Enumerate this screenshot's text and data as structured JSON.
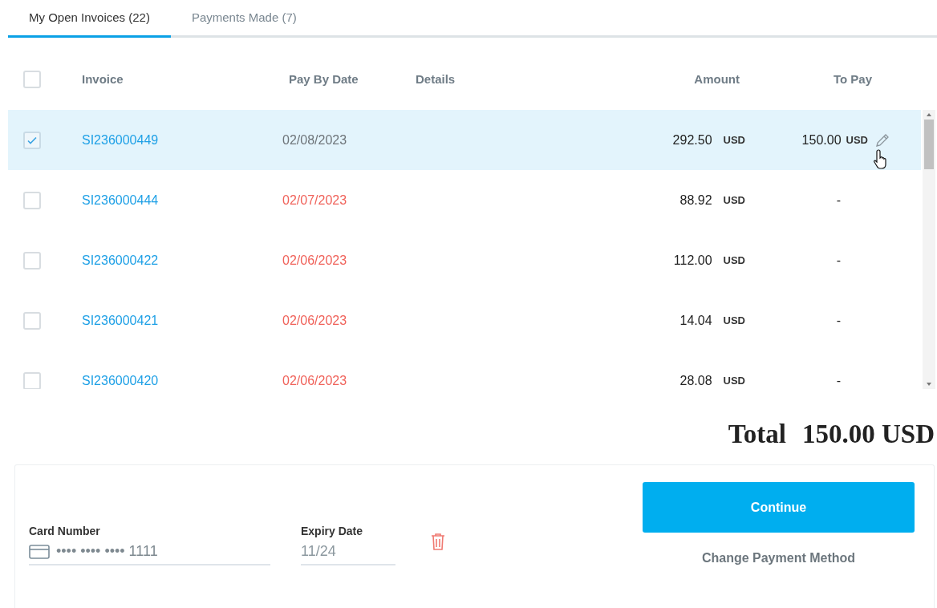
{
  "tabs": [
    {
      "label": "My Open Invoices (22)",
      "selected": true
    },
    {
      "label": "Payments Made (7)",
      "selected": false
    }
  ],
  "table": {
    "all_selected": false,
    "columns": [
      "Invoice",
      "Pay By Date",
      "Details",
      "Amount",
      "To Pay"
    ],
    "rows": [
      {
        "selected": true,
        "invoice": "SI236000449",
        "pay_by": "02/08/2023",
        "overdue": false,
        "amount": "292.50",
        "currency": "USD",
        "to_pay": "150.00",
        "to_pay_currency": "USD",
        "editable": true
      },
      {
        "selected": false,
        "invoice": "SI236000444",
        "pay_by": "02/07/2023",
        "overdue": true,
        "amount": "88.92",
        "currency": "USD",
        "to_pay": "-",
        "editable": false
      },
      {
        "selected": false,
        "invoice": "SI236000422",
        "pay_by": "02/06/2023",
        "overdue": true,
        "amount": "112.00",
        "currency": "USD",
        "to_pay": "-",
        "editable": false
      },
      {
        "selected": false,
        "invoice": "SI236000421",
        "pay_by": "02/06/2023",
        "overdue": true,
        "amount": "14.04",
        "currency": "USD",
        "to_pay": "-",
        "editable": false
      },
      {
        "selected": false,
        "invoice": "SI236000420",
        "pay_by": "02/06/2023",
        "overdue": true,
        "amount": "28.08",
        "currency": "USD",
        "to_pay": "-",
        "editable": false
      }
    ]
  },
  "total": {
    "label": "Total",
    "value": "150.00 USD"
  },
  "payment": {
    "card_label": "Card Number",
    "card_value": "•••• •••• •••• 1111",
    "expiry_label": "Expiry Date",
    "expiry_value": "11/24",
    "continue_button": "Continue",
    "change_link": "Change Payment Method"
  }
}
